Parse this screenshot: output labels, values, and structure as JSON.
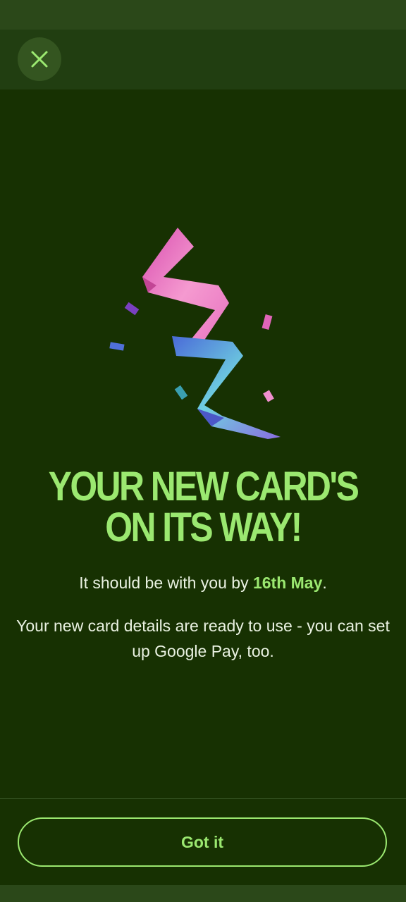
{
  "screen": {
    "close_icon": "close-icon",
    "illustration_icon": "ribbon-confetti-icon"
  },
  "headline": {
    "line1": "YOUR NEW CARD'S",
    "line2": "ON ITS WAY!"
  },
  "delivery": {
    "prefix": "It should be with you by ",
    "date": "16th May",
    "suffix": "."
  },
  "details": {
    "text": "Your new card details are ready to use - you can set up Google Pay, too."
  },
  "actions": {
    "got_it_label": "Got it"
  },
  "colors": {
    "background": "#173102",
    "accent": "#9be870",
    "text": "#eaf2e2"
  }
}
